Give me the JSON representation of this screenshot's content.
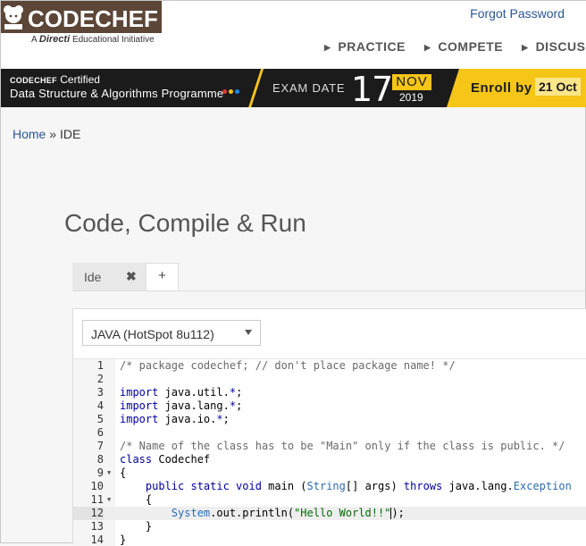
{
  "brand": {
    "name": "CODECHEF",
    "tagline_prefix": "A",
    "tagline_brand": "Directi",
    "tagline_suffix": "Educational Initiative"
  },
  "header": {
    "forgot_password": "Forgot Password",
    "nav": [
      "PRACTICE",
      "COMPETE",
      "DISCUSS"
    ]
  },
  "banner": {
    "cert_brand": "CODECHEF",
    "cert_label": "Certified",
    "program": "Data Structure & Algorithms Programme",
    "exam_label": "EXAM DATE",
    "day": "17",
    "month": "NOV",
    "year": "2019",
    "enroll_label": "Enroll by",
    "enroll_date": "21 Oct",
    "colors": {
      "accent": "#f5c518",
      "dark": "#1b1b1b"
    }
  },
  "breadcrumb": {
    "home": "Home",
    "sep": " » ",
    "current": "IDE"
  },
  "page_title": "Code, Compile & Run",
  "tabs": {
    "ide_label": "Ide",
    "close_symbol": "✖",
    "add_symbol": "+"
  },
  "language": {
    "selected": "JAVA (HotSpot 8u112)"
  },
  "editor": {
    "lines": [
      "1",
      "2",
      "3",
      "4",
      "5",
      "6",
      "7",
      "8",
      "9",
      "10",
      "11",
      "12",
      "13",
      "14"
    ],
    "active_line": 12,
    "code": {
      "l1": "/* package codechef; // don't place package name! */",
      "l4_import": "import",
      "l4_rest": " java.util.",
      "l5_rest": " java.lang.",
      "l6_rest": " java.io.",
      "star": "*",
      "semi": ";",
      "l7": "/* Name of the class has to be \"Main\" only if the class is public. */",
      "l8_kw": "class",
      "l8_name": " Codechef",
      "brace_open": "{",
      "brace_close": "}",
      "l10_mods": "public static void",
      "l10_main": " main (",
      "l10_string": "String",
      "l10_args": "[] args) ",
      "l10_throws": "throws",
      "l10_pkg": " java.lang.",
      "l10_exc": "Exception",
      "l12_system": "System",
      "l12_call": ".out.println(",
      "l12_str": "\"Hello World!!\"",
      "l12_end": ");"
    }
  }
}
